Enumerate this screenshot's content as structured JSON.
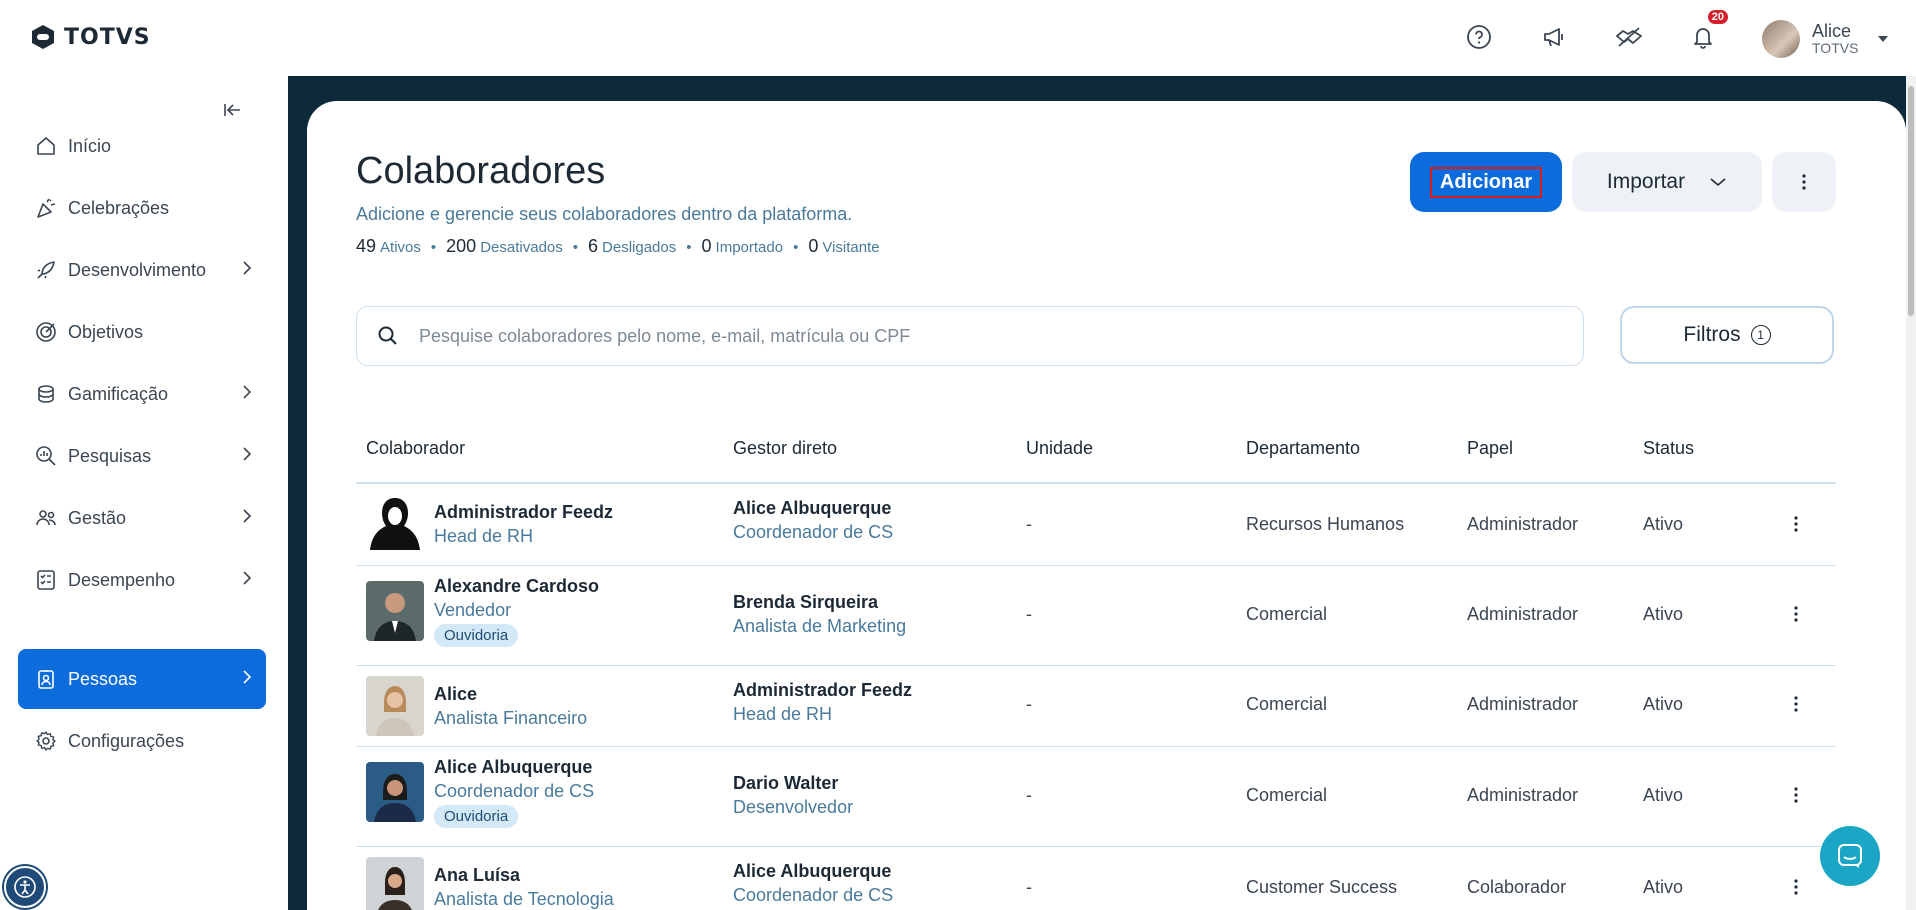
{
  "brand": {
    "name": "TOTVS"
  },
  "header": {
    "notifications_count": "20",
    "user": {
      "name": "Alice",
      "org": "TOTVS"
    },
    "icons": [
      "help-icon",
      "megaphone-icon",
      "handshake-icon",
      "bell-icon"
    ]
  },
  "sidebar": {
    "items": [
      {
        "label": "Início",
        "icon": "home-icon",
        "has_children": false,
        "active": false
      },
      {
        "label": "Celebrações",
        "icon": "party-icon",
        "has_children": false,
        "active": false
      },
      {
        "label": "Desenvolvimento",
        "icon": "rocket-icon",
        "has_children": true,
        "active": false
      },
      {
        "label": "Objetivos",
        "icon": "target-icon",
        "has_children": false,
        "active": false
      },
      {
        "label": "Gamificação",
        "icon": "coins-icon",
        "has_children": true,
        "active": false
      },
      {
        "label": "Pesquisas",
        "icon": "survey-icon",
        "has_children": true,
        "active": false
      },
      {
        "label": "Gestão",
        "icon": "people-icon",
        "has_children": true,
        "active": false
      },
      {
        "label": "Desempenho",
        "icon": "checklist-icon",
        "has_children": true,
        "active": false
      },
      {
        "label": "Pessoas",
        "icon": "badge-icon",
        "has_children": true,
        "active": true
      },
      {
        "label": "Configurações",
        "icon": "gear-icon",
        "has_children": false,
        "active": false
      }
    ]
  },
  "page": {
    "title": "Colaboradores",
    "subtitle": "Adicione e gerencie seus colaboradores dentro da plataforma.",
    "stats": [
      {
        "value": "49",
        "label": "Ativos"
      },
      {
        "value": "200",
        "label": "Desativados"
      },
      {
        "value": "6",
        "label": "Desligados"
      },
      {
        "value": "0",
        "label": "Importado"
      },
      {
        "value": "0",
        "label": "Visitante"
      }
    ],
    "add_label": "Adicionar",
    "import_label": "Importar",
    "filter_label": "Filtros",
    "filter_count": "1",
    "search_placeholder": "Pesquise colaboradores pelo nome, e-mail, matrícula ou CPF"
  },
  "table": {
    "columns": [
      "Colaborador",
      "Gestor direto",
      "Unidade",
      "Departamento",
      "Papel",
      "Status"
    ],
    "rows": [
      {
        "name": "Administrador Feedz",
        "role": "Head de RH",
        "tag": "",
        "manager": "Alice Albuquerque",
        "manager_role": "Coordenador de CS",
        "unit": "-",
        "department": "Recursos Humanos",
        "papel": "Administrador",
        "status": "Ativo"
      },
      {
        "name": "Alexandre Cardoso",
        "role": "Vendedor",
        "tag": "Ouvidoria",
        "manager": "Brenda Sirqueira",
        "manager_role": "Analista de Marketing",
        "unit": "-",
        "department": "Comercial",
        "papel": "Administrador",
        "status": "Ativo"
      },
      {
        "name": "Alice",
        "role": "Analista Financeiro",
        "tag": "",
        "manager": "Administrador Feedz",
        "manager_role": "Head de RH",
        "unit": "-",
        "department": "Comercial",
        "papel": "Administrador",
        "status": "Ativo"
      },
      {
        "name": "Alice Albuquerque",
        "role": "Coordenador de CS",
        "tag": "Ouvidoria",
        "manager": "Dario Walter",
        "manager_role": "Desenvolvedor",
        "unit": "-",
        "department": "Comercial",
        "papel": "Administrador",
        "status": "Ativo"
      },
      {
        "name": "Ana Luísa",
        "role": "Analista de Tecnologia",
        "tag": "",
        "manager": "Alice Albuquerque",
        "manager_role": "Coordenador de CS",
        "unit": "-",
        "department": "Customer Success",
        "papel": "Colaborador",
        "status": "Ativo"
      }
    ]
  }
}
